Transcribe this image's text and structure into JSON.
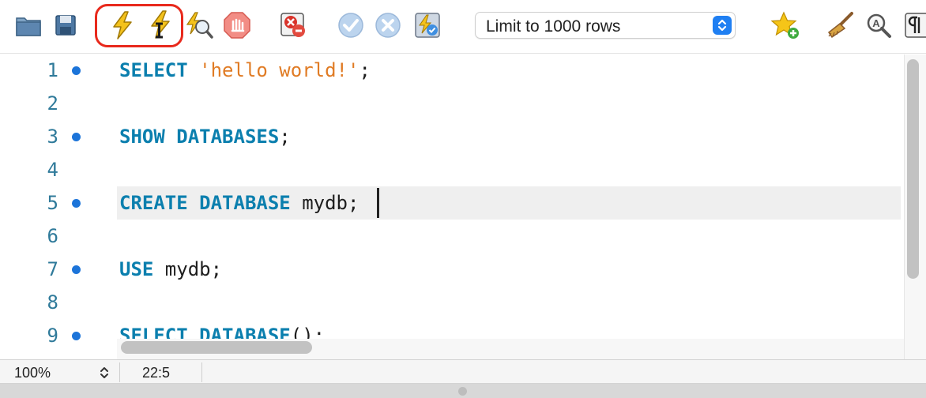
{
  "toolbar": {
    "buttons": [
      {
        "icon": "open-folder-icon"
      },
      {
        "icon": "save-icon"
      },
      {
        "icon": "execute-all-icon"
      },
      {
        "icon": "execute-current-statement-icon"
      },
      {
        "icon": "explain-icon"
      },
      {
        "icon": "stop-icon"
      },
      {
        "icon": "toggle-stop-on-error-icon"
      },
      {
        "icon": "commit-icon"
      },
      {
        "icon": "rollback-icon"
      },
      {
        "icon": "autocommit-icon"
      },
      {
        "icon": "add-snippet-icon"
      },
      {
        "icon": "beautify-icon"
      },
      {
        "icon": "find-icon"
      },
      {
        "icon": "invisible-characters-icon"
      }
    ],
    "highlight_color": "#e8291c",
    "limit_select": {
      "value": "Limit to 1000 rows"
    }
  },
  "editor": {
    "line_numbers": [
      "1",
      "2",
      "3",
      "4",
      "5",
      "6",
      "7",
      "8",
      "9"
    ],
    "statement_marker_lines": [
      1,
      3,
      5,
      7,
      9
    ],
    "current_line": 5,
    "lines": {
      "l1": {
        "kw": "SELECT",
        "str": "'hello world!'",
        "tail": ";"
      },
      "l3": {
        "kw": "SHOW DATABASES",
        "tail": ";"
      },
      "l5": {
        "kw": "CREATE DATABASE",
        "tail": " mydb;"
      },
      "l7": {
        "kw": "USE",
        "tail": " mydb;"
      },
      "l9": {
        "kw": "SELECT DATABASE",
        "tail": "();"
      }
    },
    "colors": {
      "keyword": "#0b7fae",
      "string": "#e07b24",
      "line_number": "#2f7a9a",
      "marker": "#1c74d9"
    }
  },
  "status": {
    "zoom": "100%",
    "cursor_position": "22:5"
  }
}
